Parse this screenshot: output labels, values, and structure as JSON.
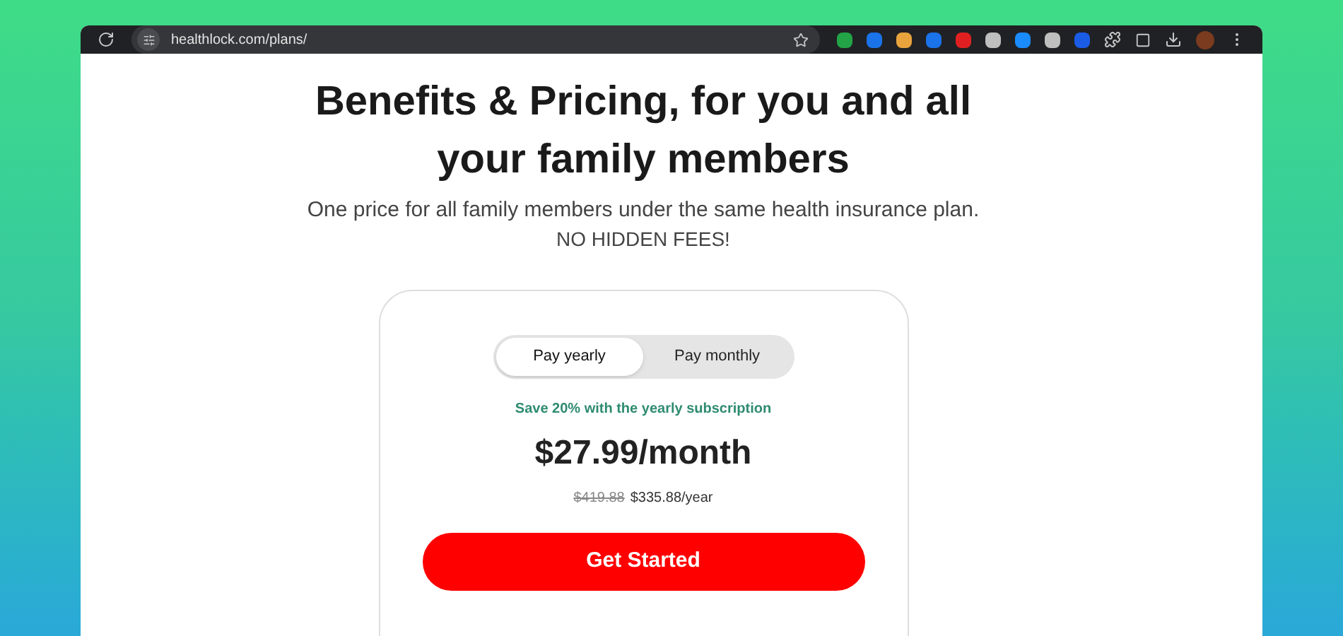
{
  "browser": {
    "url": "healthlock.com/plans/",
    "extensions": [
      {
        "color": "#22a447"
      },
      {
        "color": "#1a73e8"
      },
      {
        "color": "#e8a33d"
      },
      {
        "color": "#1a73e8"
      },
      {
        "color": "#e02020"
      },
      {
        "color": "#bfbfbf"
      },
      {
        "color": "#1a8cff"
      },
      {
        "color": "#bfbfbf"
      },
      {
        "color": "#1a5ce6"
      }
    ]
  },
  "page": {
    "title": "Benefits & Pricing, for you and all your family members",
    "subtitle": "One price for all family members under the same health insurance plan.",
    "notice": "NO HIDDEN FEES!",
    "billing_tabs": [
      {
        "label": "Pay yearly",
        "selected": true
      },
      {
        "label": "Pay monthly",
        "selected": false
      }
    ],
    "savings": "Save 20% with the yearly subscription",
    "price": "$27.99/month",
    "old_price": "$419.88",
    "yearly_price": "$335.88/year",
    "cta": "Get Started"
  }
}
